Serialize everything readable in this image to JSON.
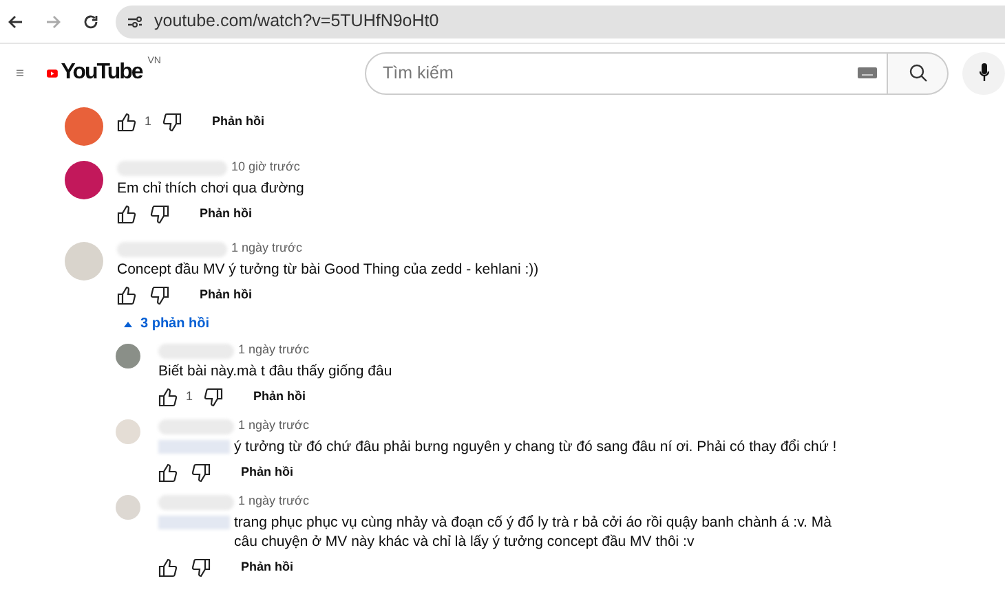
{
  "browser": {
    "url": "youtube.com/watch?v=5TUHfN9oHt0"
  },
  "header": {
    "logo": "YouTube",
    "region": "VN",
    "search": {
      "placeholder": "Tìm kiếm"
    }
  },
  "comments": [
    {
      "color": "#e8613a",
      "likes": "1",
      "reply_label": "Phản hồi"
    },
    {
      "color": "#c2185b",
      "time": "10 giờ trước",
      "text": "Em chỉ thích chơi qua đường",
      "reply_label": "Phản hồi"
    },
    {
      "color": "#d9d4cc",
      "time": "1 ngày trước",
      "text": "Concept đầu MV ý tưởng từ bài Good Thing của zedd - kehlani :))",
      "reply_label": "Phản hồi",
      "replies_toggle": {
        "label": "3 phản hồi",
        "expanded": true
      },
      "replies": [
        {
          "color": "#8a8f88",
          "time": "1 ngày trước",
          "text": "Biết bài này.mà t đâu thấy giống đâu",
          "likes": "1",
          "reply_label": "Phản hồi"
        },
        {
          "color": "#e4ddd5",
          "mention": true,
          "time": "1 ngày trước",
          "text": "ý tưởng từ đó chứ đâu phải bưng nguyên y chang từ đó sang đâu ní ơi. Phải có thay đổi chứ !",
          "reply_label": "Phản hồi"
        },
        {
          "color": "#ddd8d2",
          "mention": true,
          "time": "1 ngày trước",
          "text": "trang phục phục vụ cùng nhảy và đoạn cố ý đổ ly trà r bả cởi áo rồi quậy banh chành á :v. Mà câu chuyện ở MV này khác và chỉ là lấy ý tưởng concept đầu MV thôi :v",
          "reply_label": "Phản hồi"
        }
      ]
    }
  ]
}
